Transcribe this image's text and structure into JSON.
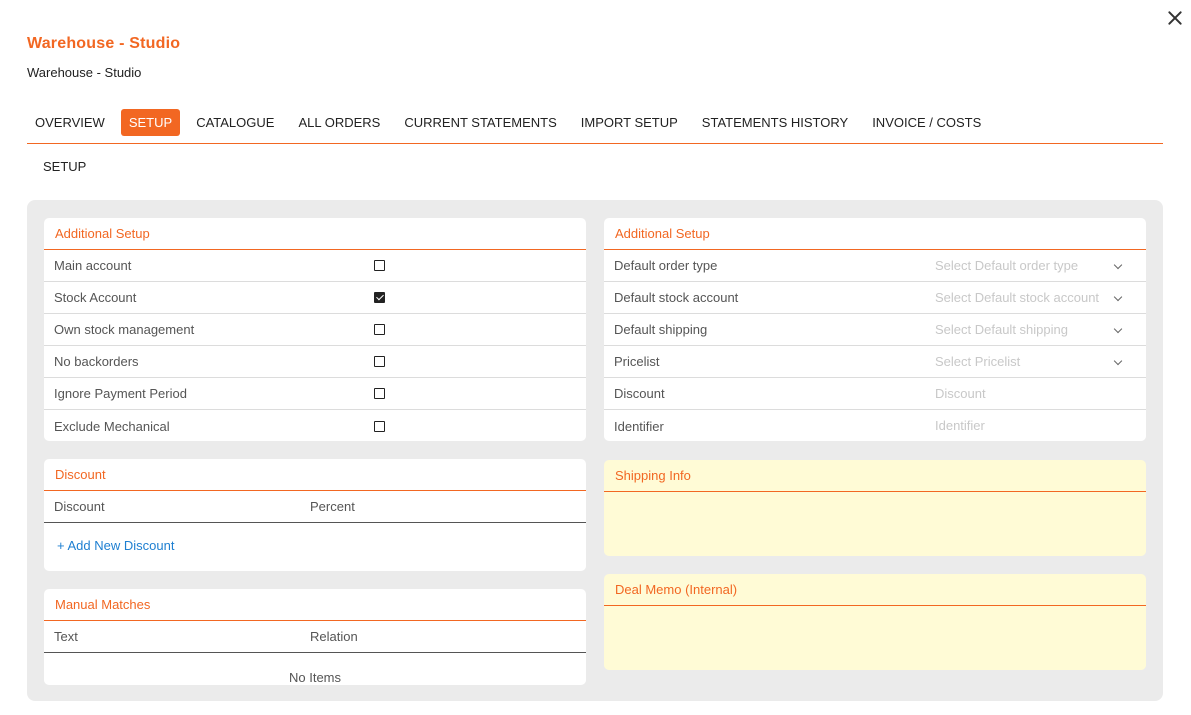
{
  "header": {
    "title": "Warehouse - Studio",
    "subtitle": "Warehouse - Studio"
  },
  "tabs": [
    {
      "label": "OVERVIEW",
      "active": false
    },
    {
      "label": "SETUP",
      "active": true
    },
    {
      "label": "CATALOGUE",
      "active": false
    },
    {
      "label": "ALL ORDERS",
      "active": false
    },
    {
      "label": "CURRENT STATEMENTS",
      "active": false
    },
    {
      "label": "IMPORT SETUP",
      "active": false
    },
    {
      "label": "STATEMENTS HISTORY",
      "active": false
    },
    {
      "label": "INVOICE / COSTS",
      "active": false
    }
  ],
  "subtab": "SETUP",
  "colors": {
    "accent": "#f26722",
    "link": "#1e7fd1",
    "note_bg": "#fffbd6"
  },
  "left_setup": {
    "title": "Additional Setup",
    "rows": [
      {
        "label": "Main account",
        "checked": false
      },
      {
        "label": "Stock Account",
        "checked": true
      },
      {
        "label": "Own stock management",
        "checked": false
      },
      {
        "label": "No backorders",
        "checked": false
      },
      {
        "label": "Ignore Payment Period",
        "checked": false
      },
      {
        "label": "Exclude Mechanical",
        "checked": false
      }
    ]
  },
  "right_setup": {
    "title": "Additional Setup",
    "rows": [
      {
        "label": "Default order type",
        "placeholder": "Select Default order type",
        "kind": "select"
      },
      {
        "label": "Default stock account",
        "placeholder": "Select Default stock account",
        "kind": "select"
      },
      {
        "label": "Default shipping",
        "placeholder": "Select Default shipping",
        "kind": "select"
      },
      {
        "label": "Pricelist",
        "placeholder": "Select Pricelist",
        "kind": "select"
      },
      {
        "label": "Discount",
        "placeholder": "Discount",
        "kind": "text"
      },
      {
        "label": "Identifier",
        "placeholder": "Identifier",
        "kind": "text"
      }
    ]
  },
  "discount": {
    "title": "Discount",
    "col1": "Discount",
    "col2": "Percent",
    "add_label": "+ Add New Discount"
  },
  "manual_matches": {
    "title": "Manual Matches",
    "col1": "Text",
    "col2": "Relation",
    "empty": "No Items"
  },
  "shipping_info": {
    "title": "Shipping Info"
  },
  "deal_memo": {
    "title": "Deal Memo (Internal)"
  }
}
